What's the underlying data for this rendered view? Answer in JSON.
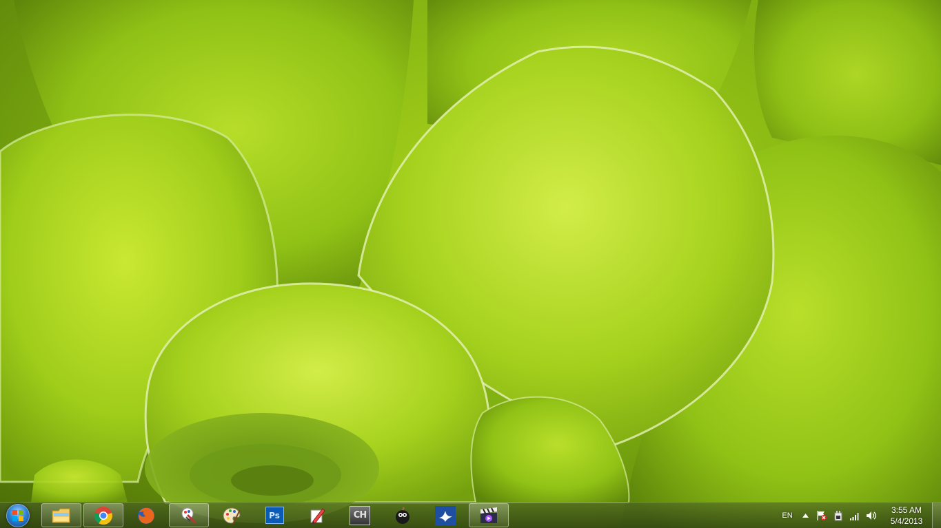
{
  "desktop": {
    "wallpaper": "green-succulent-leaves"
  },
  "taskbar": {
    "start_icon": "windows-start-orb",
    "tasks": [
      {
        "name": "windows-explorer",
        "icon": "folder-icon",
        "open": true
      },
      {
        "name": "google-chrome",
        "icon": "chrome-icon",
        "open": true
      },
      {
        "name": "firefox",
        "icon": "firefox-icon",
        "open": false
      },
      {
        "name": "paint-tool",
        "icon": "brush-icon",
        "open": true
      },
      {
        "name": "paint",
        "icon": "palette-icon",
        "open": false
      },
      {
        "name": "photoshop",
        "icon": "photoshop-icon",
        "label": "Ps",
        "open": false
      },
      {
        "name": "drawing-app",
        "icon": "pencil-icon",
        "open": false
      },
      {
        "name": "ch-app",
        "icon": "ch-icon",
        "label": "CH",
        "open": false
      },
      {
        "name": "bomb-game",
        "icon": "bomb-icon",
        "open": false
      },
      {
        "name": "bird-app",
        "icon": "bird-icon",
        "open": false
      },
      {
        "name": "movie-maker",
        "icon": "clapperboard-icon",
        "open": true
      }
    ],
    "tray": {
      "language": "EN",
      "icons": [
        "show-hidden-icons-icon",
        "action-center-flag-icon",
        "power-icon",
        "network-signal-icon",
        "volume-icon"
      ]
    },
    "clock": {
      "time": "3:55 AM",
      "date": "5/4/2013"
    }
  },
  "colors": {
    "accent_green": "#8fc112",
    "taskbar_tint": "#3a4f18",
    "photoshop_blue": "#0a5bb5"
  }
}
